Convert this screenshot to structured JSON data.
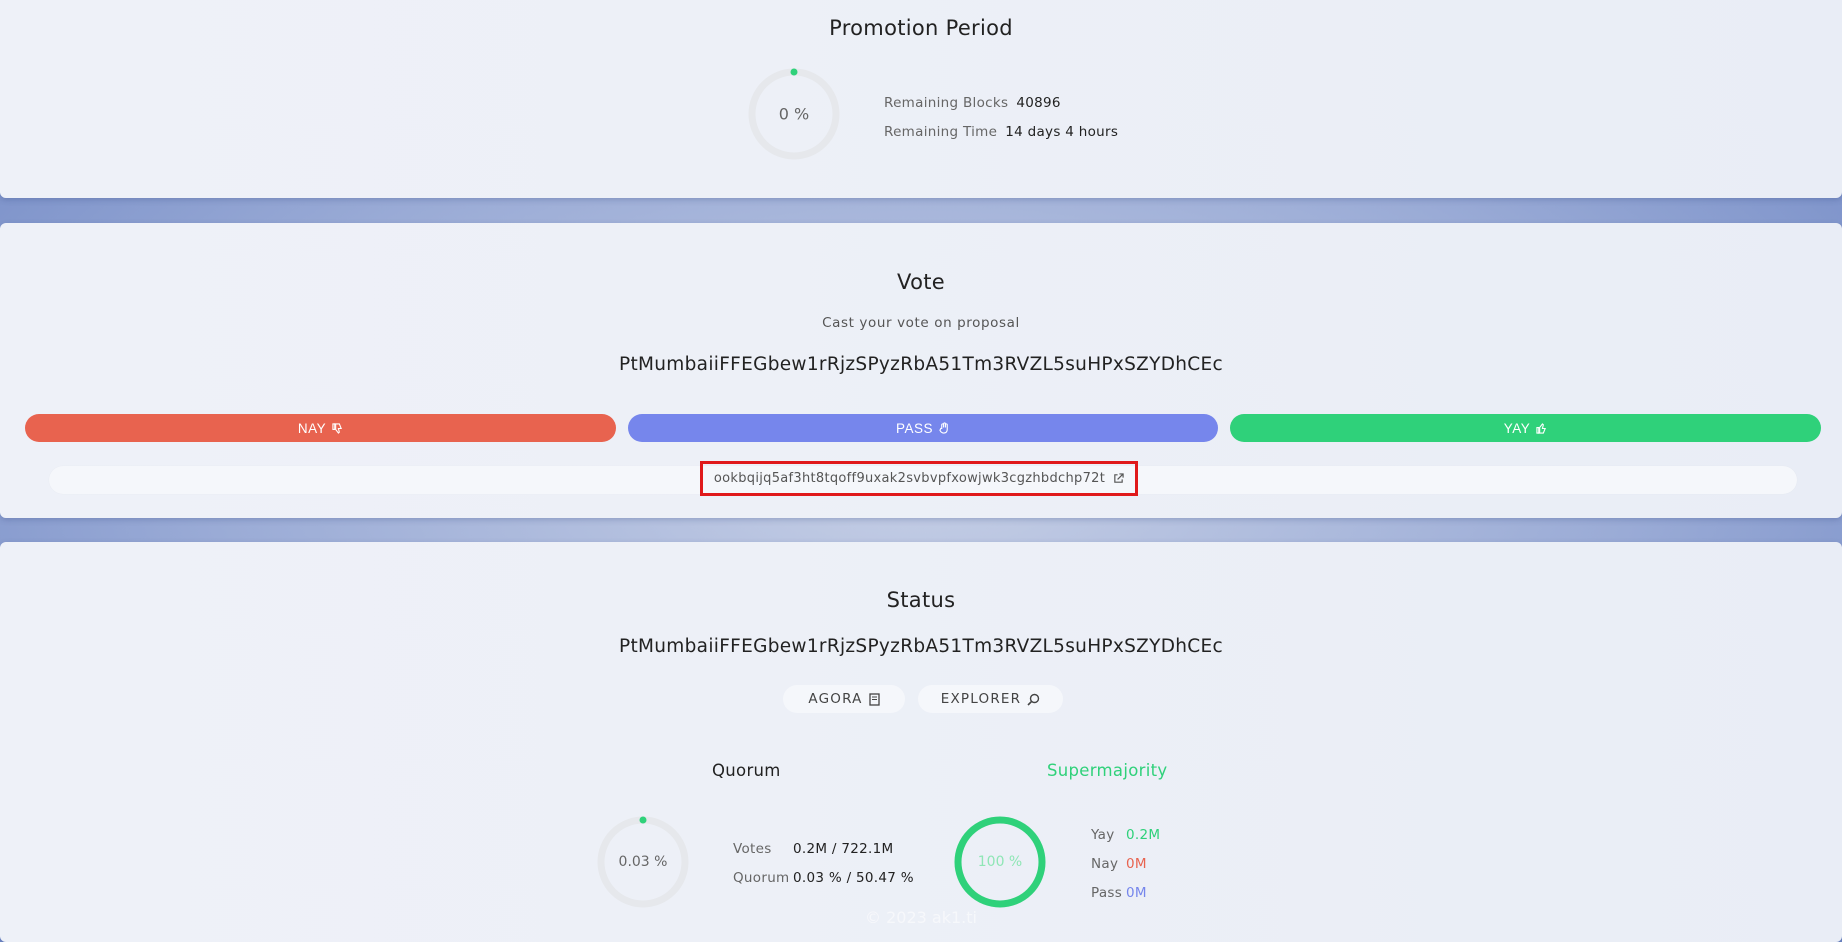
{
  "promotion": {
    "title": "Promotion Period",
    "progress_label": "0 %",
    "progress_fraction": 0.0,
    "remaining_blocks_label": "Remaining Blocks",
    "remaining_blocks_value": "40896",
    "remaining_time_label": "Remaining Time",
    "remaining_time_value": "14 days 4 hours"
  },
  "vote": {
    "title": "Vote",
    "subtitle": "Cast your vote on proposal",
    "proposal_hash": "PtMumbaiiFFEGbew1rRjzSPyzRbA51Tm3RVZL5suHPxSZYDhCEc",
    "nay_label": "NAY",
    "pass_label": "PASS",
    "yay_label": "YAY",
    "operation_hash": "ookbqijq5af3ht8tqoff9uxak2svbvpfxowjwk3cgzhbdchp72t"
  },
  "status": {
    "title": "Status",
    "proposal_hash": "PtMumbaiiFFEGbew1rRjzSPyzRbA51Tm3RVZL5suHPxSZYDhCEc",
    "agora_label": "AGORA",
    "explorer_label": "EXPLORER",
    "quorum": {
      "heading": "Quorum",
      "progress_label": "0.03 %",
      "progress_fraction": 0.0003,
      "votes_label": "Votes",
      "votes_value": "0.2M / 722.1M",
      "quorum_label": "Quorum",
      "quorum_value": "0.03 % / 50.47 %"
    },
    "supermajority": {
      "heading": "Supermajority",
      "progress_label": "100 %",
      "progress_fraction": 1.0,
      "yay_label": "Yay",
      "yay_value": "0.2M",
      "nay_label": "Nay",
      "nay_value": "0M",
      "pass_label": "Pass",
      "pass_value": "0M"
    }
  },
  "footer": {
    "text": "© 2023 ak1.ti"
  },
  "colors": {
    "nay": "#e8634f",
    "pass": "#7686ec",
    "yay": "#2fd17a",
    "highlight": "#e0191b"
  },
  "icons": {
    "nay": "thumbs-down-icon",
    "pass": "hand-icon",
    "yay": "thumbs-up-icon",
    "operation": "external-link-icon",
    "agora": "book-icon",
    "explorer": "search-icon"
  }
}
